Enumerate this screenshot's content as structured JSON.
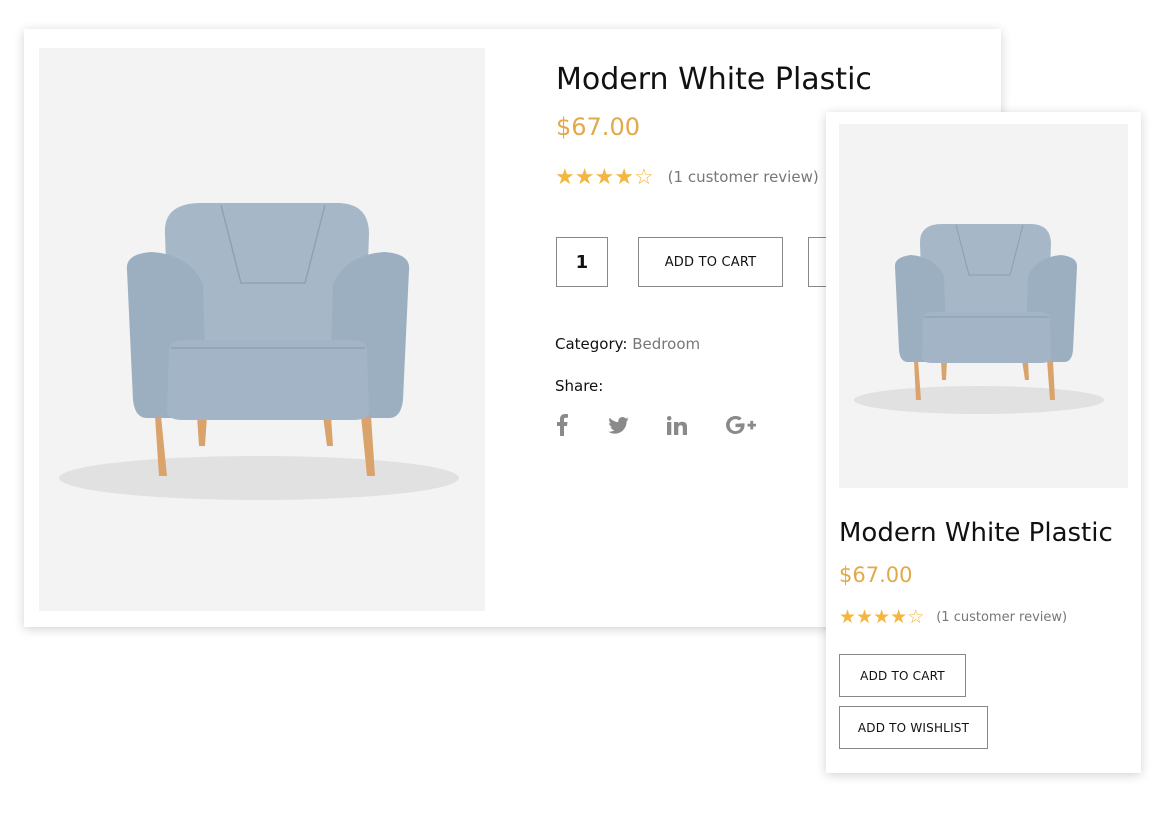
{
  "product": {
    "title": "Modern White Plastic",
    "price": "$67.00",
    "rating": 4,
    "rating_max": 5,
    "review_text": "(1 customer review)",
    "image_icon": "armchair-image"
  },
  "desktop": {
    "quantity": "1",
    "add_to_cart": "ADD TO CART",
    "category_label": "Category:",
    "category_value": "Bedroom",
    "share_label": "Share:",
    "social_icons": [
      "facebook-icon",
      "twitter-icon",
      "linkedin-icon",
      "google-plus-icon"
    ]
  },
  "mobile": {
    "add_to_cart": "ADD TO CART",
    "add_to_wishlist": "ADD TO WISHLIST"
  },
  "colors": {
    "price": "#e1a94a",
    "star": "#f4b63f",
    "chair": "#9fb1c2",
    "legs": "#d9a36b",
    "image_bg": "#f3f3f3"
  }
}
